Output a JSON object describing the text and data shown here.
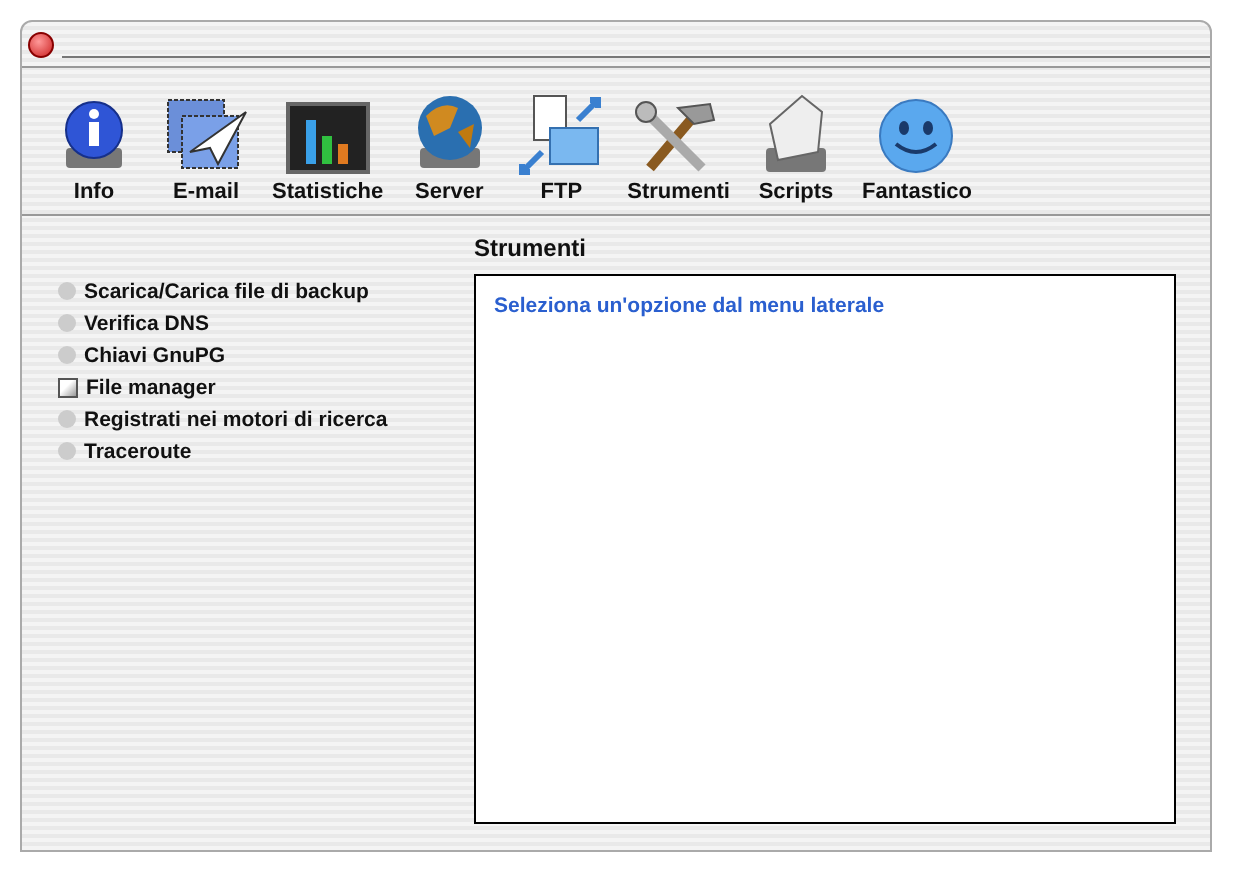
{
  "toolbar": [
    {
      "label": "Info",
      "kind": "info"
    },
    {
      "label": "E-mail",
      "kind": "mail"
    },
    {
      "label": "Statistiche",
      "kind": "chart"
    },
    {
      "label": "Server",
      "kind": "globe"
    },
    {
      "label": "FTP",
      "kind": "ftp"
    },
    {
      "label": "Strumenti",
      "kind": "tools"
    },
    {
      "label": "Scripts",
      "kind": "script"
    },
    {
      "label": "Fantastico",
      "kind": "smiley"
    }
  ],
  "section_title": "Strumenti",
  "menu": [
    {
      "label": "Scarica/Carica file di backup",
      "kind": "bullet"
    },
    {
      "label": "Verifica DNS",
      "kind": "bullet"
    },
    {
      "label": "Chiavi GnuPG",
      "kind": "bullet"
    },
    {
      "label": "File manager",
      "kind": "window"
    },
    {
      "label": "Registrati nei motori di ricerca",
      "kind": "bullet"
    },
    {
      "label": "Traceroute",
      "kind": "bullet"
    }
  ],
  "panel": {
    "message": "Seleziona un'opzione dal menu laterale"
  }
}
